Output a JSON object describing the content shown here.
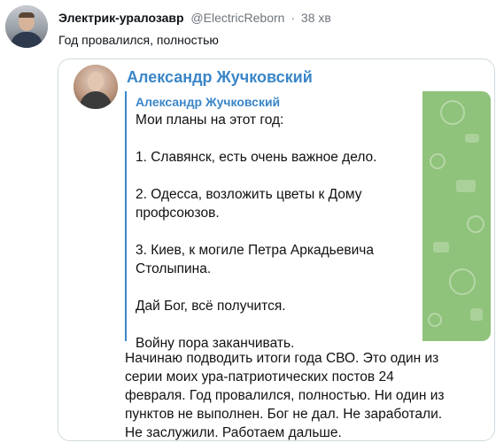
{
  "tweet": {
    "author_name": "Электрик-уралозавр",
    "author_handle": "@ElectricReborn",
    "separator": "·",
    "time": "38 хв",
    "text": "Год провалился, полностью"
  },
  "embedded_post": {
    "sender": "Александр Жучковский",
    "quoted": {
      "author": "Александр Жучковский",
      "lines": [
        "Мои планы на этот год:",
        "",
        "1. Славянск, есть очень важное дело.",
        "",
        "2. Одесса, возложить цветы к Дому",
        "профсоюзов.",
        "",
        "3. Киев, к могиле Петра Аркадьевича",
        "Столыпина.",
        "",
        "Дай Бог, всё получится.",
        "",
        "Войну пора заканчивать."
      ]
    },
    "text_lines": [
      "Начинаю подводить итоги года СВО. Это один из",
      "серии моих ура-патриотических постов 24",
      "февраля. Год провалился, полностью. Ни один из",
      "пунктов не выполнен. Бог не дал. Не заработали.",
      "Не заслужили. Работаем дальше."
    ]
  },
  "colors": {
    "telegram_accent": "#3a86c8",
    "secondary_text": "#6e767d",
    "card_border": "#cfd9de",
    "chat_background": "#8fc27a"
  }
}
